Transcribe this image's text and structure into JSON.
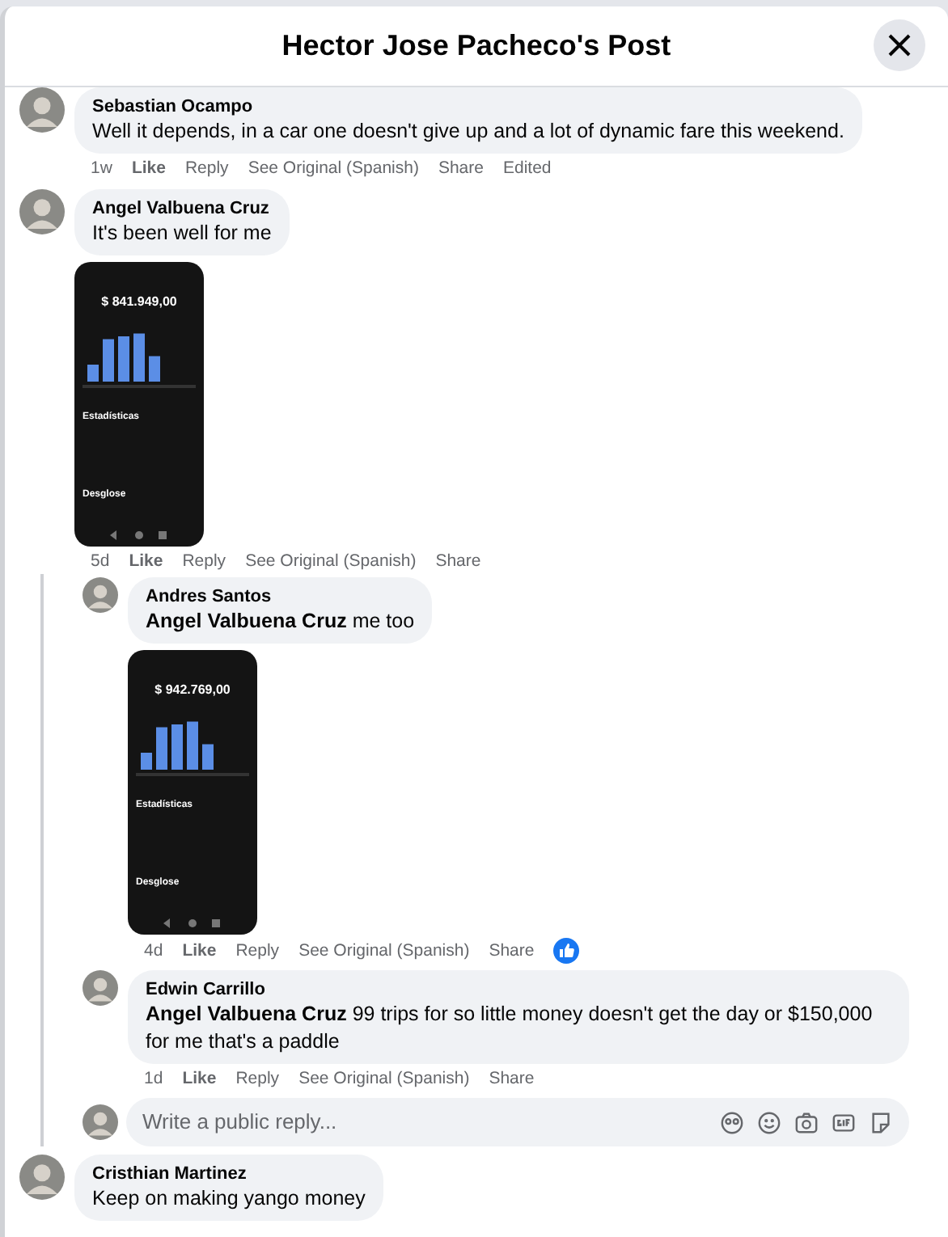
{
  "dialog": {
    "title": "Hector Jose Pacheco's Post"
  },
  "comments": [
    {
      "author": "Sebastian Ocampo",
      "text": "Well it depends, in a car one doesn't give up and a lot of dynamic fare this weekend.",
      "time": "1w",
      "actions": [
        "Like",
        "Reply",
        "See Original (Spanish)",
        "Share"
      ],
      "note": "Edited"
    },
    {
      "author": "Angel Valbuena Cruz",
      "text": "It's been well for me",
      "time": "5d",
      "actions": [
        "Like",
        "Reply",
        "See Original (Spanish)",
        "Share"
      ],
      "image": {
        "kind": "phone_screenshot",
        "amount": "$ 841.949,00",
        "section": "Estadísticas",
        "section_2": "Desglose"
      },
      "replies": [
        {
          "author": "Andres Santos",
          "text": "**Angel Valbuena Cruz** me too",
          "time": "4d",
          "actions": [
            "Like",
            "Reply",
            "See Original (Spanish)",
            "Share"
          ],
          "reacted": true,
          "image": {
            "kind": "phone_screenshot",
            "amount": "$ 942.769,00",
            "section": "Estadísticas",
            "section_2": "Desglose"
          }
        },
        {
          "author": "Edwin Carrillo",
          "text": "**Angel Valbuena Cruz** 99 trips for so little money doesn't get the day or $150,000 for me that's a paddle",
          "time": "1d",
          "actions": [
            "Like",
            "Reply",
            "See Original (Spanish)",
            "Share"
          ],
          "reacted": false
        }
      ],
      "reply_box": {
        "placeholder": "Write a public reply..."
      }
    },
    {
      "author": "Cristhian Martinez",
      "text": "Keep on making yango money"
    }
  ]
}
